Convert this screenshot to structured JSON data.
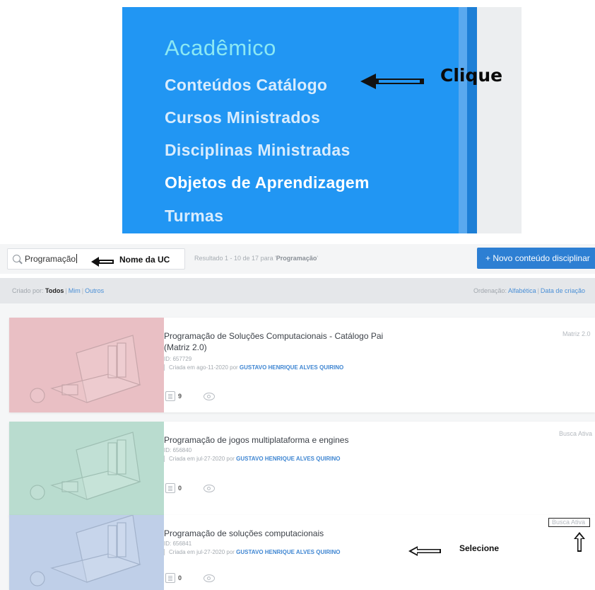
{
  "menu": {
    "title": "Acadêmico",
    "items": [
      {
        "label": "Conteúdos Catálogo"
      },
      {
        "label": "Cursos Ministrados"
      },
      {
        "label": "Disciplinas Ministradas"
      },
      {
        "label": "Objetos de Aprendizagem"
      },
      {
        "label": "Turmas"
      }
    ],
    "annotation": "Clique"
  },
  "search": {
    "value": "Programação",
    "annotation": "Nome da UC",
    "result_prefix": "Resultado 1 - 10 de 17 para '",
    "result_query": "Programação",
    "result_suffix": "'",
    "new_button_label": "+ Novo conteúdo disciplinar"
  },
  "filters": {
    "created_by_label": "Criado por:",
    "created_by_options": [
      "Todos",
      "Mim",
      "Outros"
    ],
    "order_label": "Ordenação:",
    "order_options": [
      "Alfabética",
      "Data de criação"
    ]
  },
  "cards": [
    {
      "title": "Programação de Soluções Computacionais - Catálogo Pai (Matriz 2.0)",
      "id": "ID: 657729",
      "created_prefix": "Criada em ago-11-2020 por",
      "author": "GUSTAVO HENRIQUE ALVES QUIRINO",
      "status": "Matriz 2.0",
      "count": "9"
    },
    {
      "title": "Programação de jogos multiplataforma e engines",
      "id": "ID: 656840",
      "created_prefix": "Criada em jul-27-2020 por",
      "author": "GUSTAVO HENRIQUE ALVES QUIRINO",
      "status": "Busca Ativa",
      "count": "0"
    },
    {
      "title": "Programação de soluções computacionais",
      "id": "ID: 656841",
      "created_prefix": "Criada em jul-27-2020 por",
      "author": "GUSTAVO HENRIQUE ALVES QUIRINO",
      "status": "Busca Ativa",
      "count": "0",
      "annotation": "Selecione"
    }
  ],
  "colors": {
    "menu_bg": "#2196f3",
    "menu_title": "#8be8f3",
    "primary_button": "#2d7fd3",
    "link": "#3f86d2",
    "thumb_pink": "#e9bfc4",
    "thumb_green": "#b9dccf",
    "thumb_blue": "#bfcfe8"
  }
}
